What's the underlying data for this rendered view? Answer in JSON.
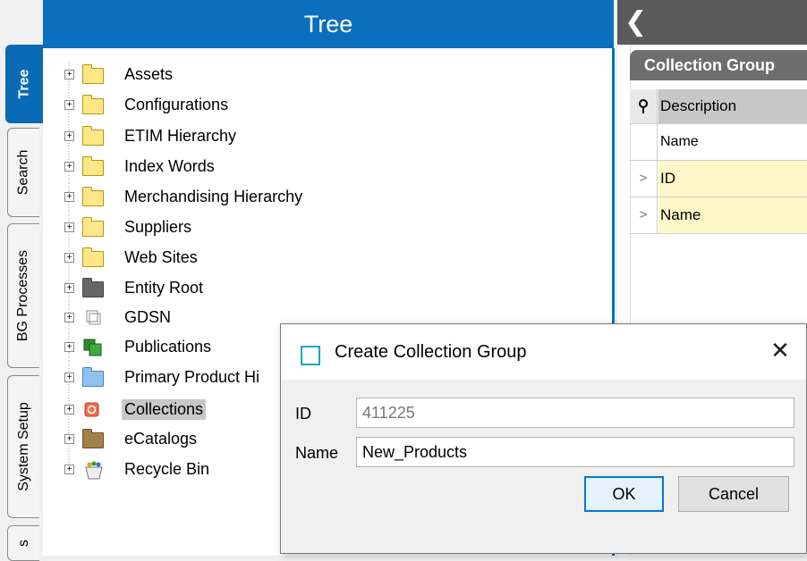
{
  "tabs": [
    {
      "label": "Tree",
      "active": true
    },
    {
      "label": "Search",
      "active": false
    },
    {
      "label": "BG Processes",
      "active": false
    },
    {
      "label": "System Setup",
      "active": false
    },
    {
      "label": "s",
      "active": false
    }
  ],
  "tree": {
    "title": "Tree",
    "nodes": [
      {
        "label": "Assets",
        "icon": "folder-icon"
      },
      {
        "label": "Configurations",
        "icon": "folder-icon"
      },
      {
        "label": "ETIM Hierarchy",
        "icon": "folder-icon"
      },
      {
        "label": "Index Words",
        "icon": "folder-icon"
      },
      {
        "label": "Merchandising Hierarchy",
        "icon": "folder-icon"
      },
      {
        "label": "Suppliers",
        "icon": "folder-icon"
      },
      {
        "label": "Web Sites",
        "icon": "folder-icon"
      },
      {
        "label": "Entity Root",
        "icon": "dark-folder-icon"
      },
      {
        "label": "GDSN",
        "icon": "cube-icon"
      },
      {
        "label": "Publications",
        "icon": "publications-icon"
      },
      {
        "label": "Primary Product Hi",
        "icon": "blue-folder-icon"
      },
      {
        "label": "Collections",
        "icon": "collections-icon",
        "selected": true
      },
      {
        "label": "eCatalogs",
        "icon": "catalog-folder-icon"
      },
      {
        "label": "Recycle Bin",
        "icon": "recycle-bin-icon"
      }
    ]
  },
  "right": {
    "back_label": "❮",
    "tab_label": "Collection Group",
    "grid_header": "Description",
    "subheader": "Name",
    "rows": [
      {
        "expander": ">",
        "label": "ID"
      },
      {
        "expander": ">",
        "label": "Name"
      }
    ]
  },
  "dialog": {
    "title": "Create Collection Group",
    "close": "✕",
    "id_label": "ID",
    "id_value": "411225",
    "name_label": "Name",
    "name_value": "New_Products",
    "ok": "OK",
    "cancel": "Cancel"
  },
  "colors": {
    "accent": "#0b6fbe",
    "selection": "#c8c8c8",
    "highlight_row": "#fff9c9"
  }
}
